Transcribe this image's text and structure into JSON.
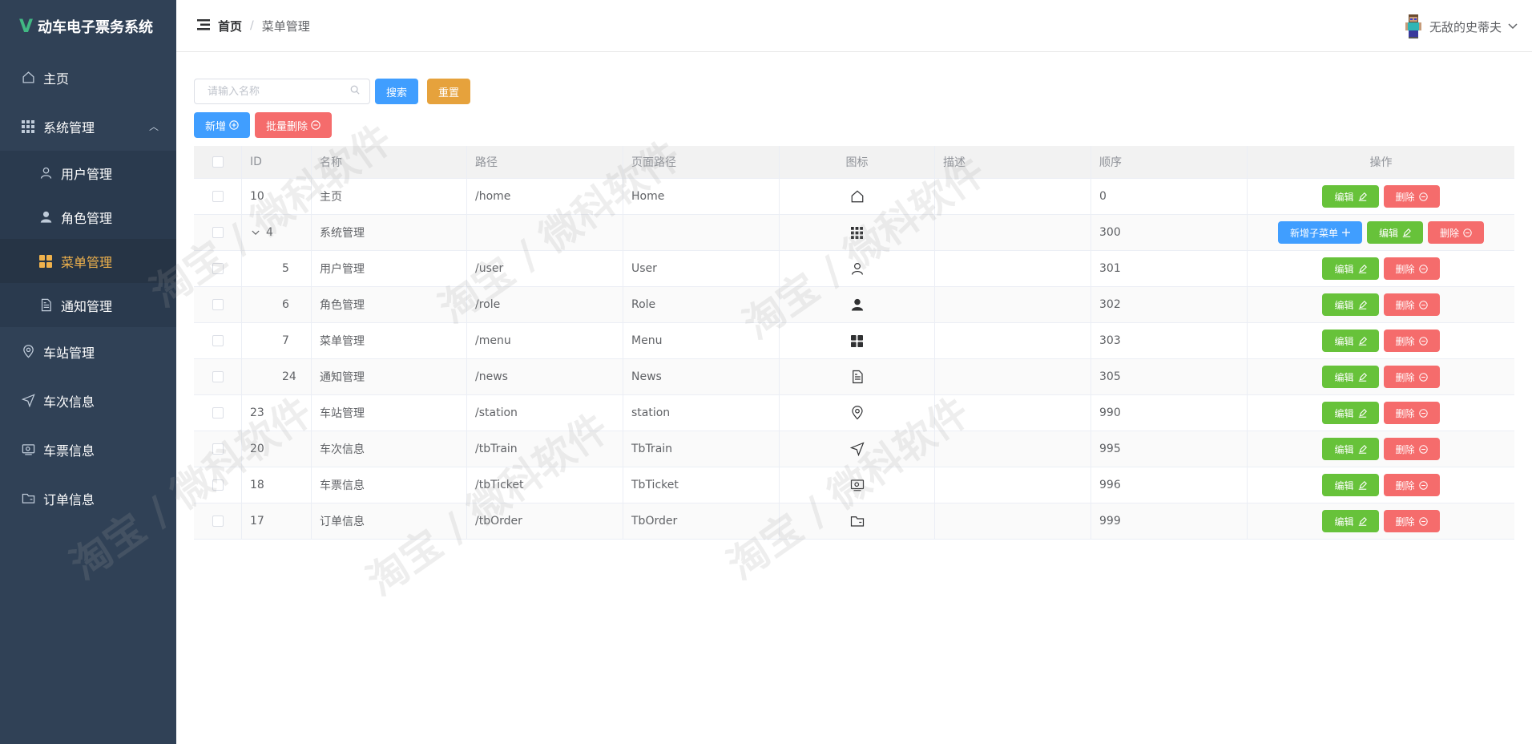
{
  "brand": {
    "logo": "V",
    "title": "动车电子票务系统"
  },
  "sidebar": {
    "items": [
      {
        "label": "主页",
        "icon": "home-icon"
      },
      {
        "label": "系统管理",
        "icon": "grid-icon",
        "expanded": true,
        "children": [
          {
            "label": "用户管理",
            "icon": "user-icon"
          },
          {
            "label": "角色管理",
            "icon": "user-filled-icon"
          },
          {
            "label": "菜单管理",
            "icon": "menu-icon",
            "active": true
          },
          {
            "label": "通知管理",
            "icon": "document-icon"
          }
        ]
      },
      {
        "label": "车站管理",
        "icon": "location-icon"
      },
      {
        "label": "车次信息",
        "icon": "position-icon"
      },
      {
        "label": "车票信息",
        "icon": "ticket-icon"
      },
      {
        "label": "订单信息",
        "icon": "folder-icon"
      }
    ]
  },
  "header": {
    "breadcrumb_home": "首页",
    "breadcrumb_sep": "/",
    "breadcrumb_current": "菜单管理",
    "username": "无敌的史蒂夫"
  },
  "search": {
    "placeholder": "请输入名称",
    "search_label": "搜索",
    "reset_label": "重置"
  },
  "actions": {
    "add_label": "新增",
    "batch_delete_label": "批量删除"
  },
  "table": {
    "columns": [
      "ID",
      "名称",
      "路径",
      "页面路径",
      "图标",
      "描述",
      "顺序",
      "操作"
    ],
    "rows": [
      {
        "id": "10",
        "name": "主页",
        "path": "/home",
        "page": "Home",
        "icon": "home-icon",
        "desc": "",
        "order": "0"
      },
      {
        "id": "4",
        "name": "系统管理",
        "path": "",
        "page": "",
        "icon": "grid-icon",
        "desc": "",
        "order": "300",
        "expanded": true
      },
      {
        "id": "5",
        "name": "用户管理",
        "path": "/user",
        "page": "User",
        "icon": "user-icon",
        "desc": "",
        "order": "301"
      },
      {
        "id": "6",
        "name": "角色管理",
        "path": "/role",
        "page": "Role",
        "icon": "user-filled-icon",
        "desc": "",
        "order": "302"
      },
      {
        "id": "7",
        "name": "菜单管理",
        "path": "/menu",
        "page": "Menu",
        "icon": "menu-icon",
        "desc": "",
        "order": "303"
      },
      {
        "id": "24",
        "name": "通知管理",
        "path": "/news",
        "page": "News",
        "icon": "document-icon",
        "desc": "",
        "order": "305"
      },
      {
        "id": "23",
        "name": "车站管理",
        "path": "/station",
        "page": "station",
        "icon": "location-icon",
        "desc": "",
        "order": "990"
      },
      {
        "id": "20",
        "name": "车次信息",
        "path": "/tbTrain",
        "page": "TbTrain",
        "icon": "position-icon",
        "desc": "",
        "order": "995"
      },
      {
        "id": "18",
        "name": "车票信息",
        "path": "/tbTicket",
        "page": "TbTicket",
        "icon": "ticket-icon",
        "desc": "",
        "order": "996"
      },
      {
        "id": "17",
        "name": "订单信息",
        "path": "/tbOrder",
        "page": "TbOrder",
        "icon": "folder-icon",
        "desc": "",
        "order": "999"
      }
    ],
    "edit_label": "编辑",
    "delete_label": "删除",
    "add_child_label": "新增子菜单"
  },
  "watermark": "淘宝 / 微科软件",
  "colors": {
    "sidebar": "#304156",
    "active": "#f0b24c",
    "primary": "#409eff",
    "success": "#67c23a",
    "danger": "#f56c6c",
    "warning": "#e6a23c"
  }
}
